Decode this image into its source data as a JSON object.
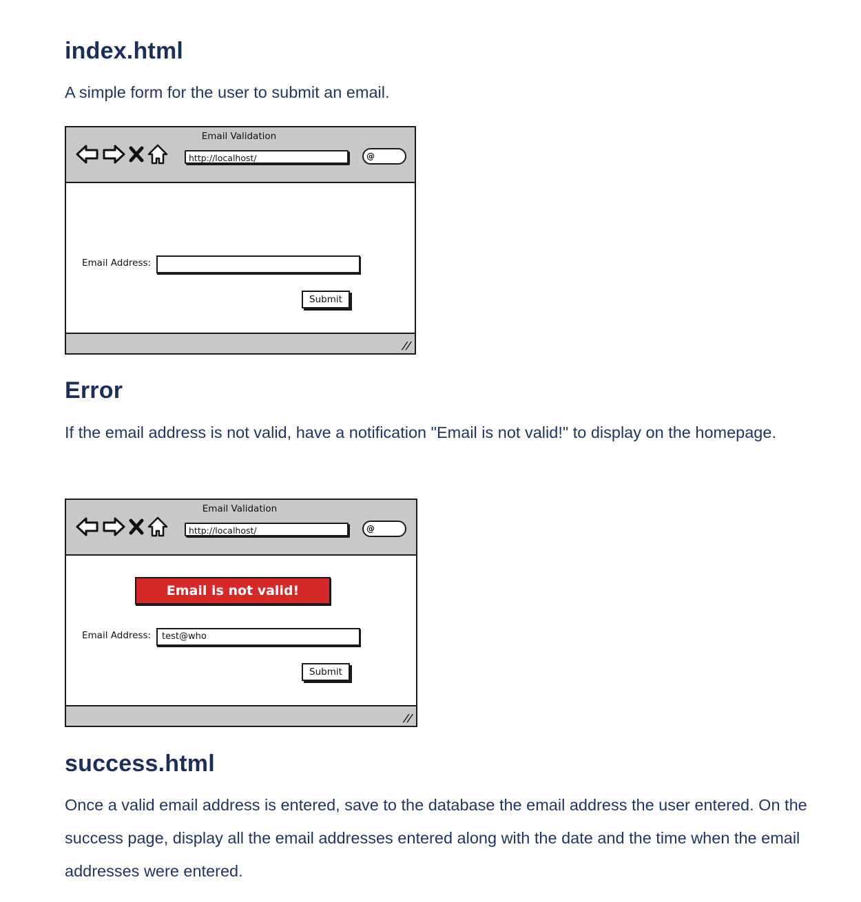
{
  "sections": {
    "index": {
      "heading": "index.html",
      "description": "A simple form for the user to submit an email."
    },
    "error": {
      "heading": "Error",
      "description": "If the email address is not valid, have a notification \"Email is not valid!\" to display on the homepage."
    },
    "success": {
      "heading": "success.html",
      "description": "Once a valid email address is entered, save to the database the email address the user entered. On the success page, display all the email addresses entered along with the date and the time when the email addresses were entered."
    }
  },
  "mockups": {
    "form": {
      "window_title": "Email Validation",
      "url": "http://localhost/",
      "email_label": "Email Address:",
      "email_value": "",
      "submit_label": "Submit"
    },
    "error": {
      "window_title": "Email Validation",
      "url": "http://localhost/",
      "alert_text": "Email is not valid!",
      "email_label": "Email Address:",
      "email_value": "test@who",
      "submit_label": "Submit"
    }
  },
  "colors": {
    "heading": "#1b2f5e",
    "body_text": "#1f3566",
    "alert_bg": "#d62a2a",
    "chrome_gray": "#c8c8c8"
  }
}
